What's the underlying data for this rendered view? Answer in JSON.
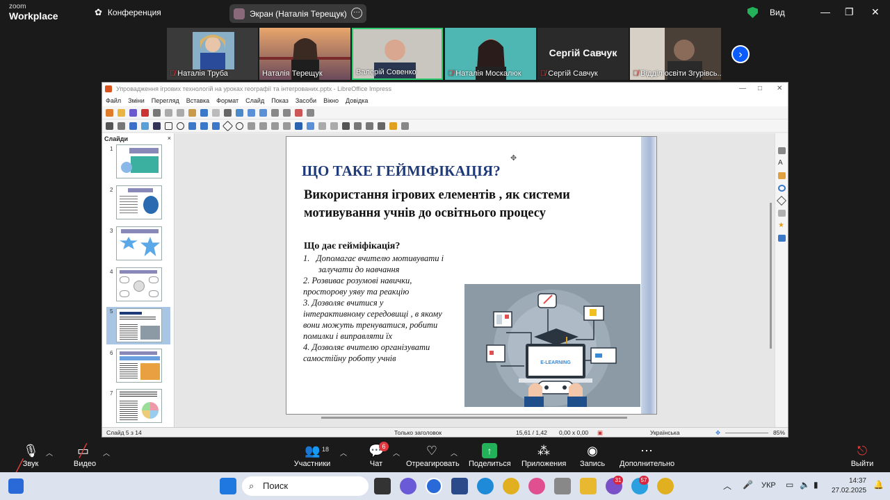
{
  "zoom": {
    "logo_line1": "zoom",
    "logo_line2": "Workplace",
    "conference_label": "Конференция",
    "screen_share_label": "Экран (Наталія Терещук)",
    "view_label": "Вид",
    "colors": {
      "accent": "#0b5cff",
      "active_speaker": "#2ecc71",
      "muted": "#e54040",
      "secure": "#23b25a"
    }
  },
  "participants": [
    {
      "name": "Наталія Труба",
      "muted": true
    },
    {
      "name": "Наталія Терещук",
      "muted": false
    },
    {
      "name": "Валерій Совенко",
      "muted": false,
      "active": true
    },
    {
      "name": "Наталія Москалюк",
      "muted": true
    },
    {
      "name": "Сергій Савчук",
      "muted": true,
      "display_text": "Сергій Савчук"
    },
    {
      "name": "Відділ освіти Згурівсь...",
      "muted": true
    }
  ],
  "impress": {
    "window_title": "Упровадження ігрових технологій на уроках географії та інтегрованих.pptx - LibreOffice Impress",
    "menu": [
      "Файл",
      "Зміни",
      "Перегляд",
      "Вставка",
      "Формат",
      "Слайд",
      "Показ",
      "Засоби",
      "Вікно",
      "Довідка"
    ],
    "slides_panel_title": "Слайди",
    "slide_numbers": [
      "1",
      "2",
      "3",
      "4",
      "5",
      "6",
      "7"
    ],
    "selected_slide": "5",
    "status": {
      "slide_of": "Слайд 5 з 14",
      "layout": "Только заголовок",
      "position": "15,61 / 1,42",
      "size": "0,00 x 0,00",
      "language": "Українська",
      "zoom": "85%"
    },
    "slide": {
      "title": "ЩО ТАКЕ ГЕЙМІФІКАЦІЯ?",
      "subtitle": "Використання  ігрових елементів , як системи мотивування учнів до освітнього процесу",
      "question": "Що дає гейміфікація?",
      "list": [
        "1.   Допомагає вчителю мотивувати і",
        "       залучати до навчання",
        "2. Розвиває розумові навички,",
        "просторову уяву та реакцію",
        "3. Дозволяє вчитися у",
        "інтерактивному середовищі , в якому",
        "вони можуть тренуватися, робити",
        "помилки і виправляти їх",
        "4. Дозволяє вчителю організувати",
        "самостійну роботу учнів"
      ],
      "image_label": "E-LEARNING"
    }
  },
  "controls": {
    "audio": "Звук",
    "video": "Видео",
    "participants": "Участники",
    "participants_count": "18",
    "chat": "Чат",
    "chat_badge": "6",
    "react": "Отреагировать",
    "share": "Поделиться",
    "apps": "Приложения",
    "record": "Запись",
    "more": "Дополнительно",
    "leave": "Выйти"
  },
  "taskbar": {
    "search": "Поиск",
    "lang": "УКР",
    "time": "14:37",
    "date": "27.02.2025",
    "badge_viber": "31",
    "badge_telegram": "57"
  }
}
